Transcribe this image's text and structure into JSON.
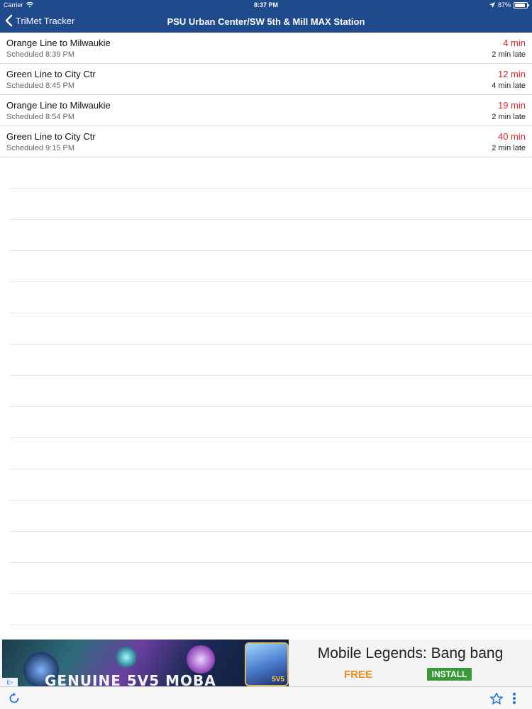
{
  "status_bar": {
    "carrier": "Carrier",
    "time": "8:37 PM",
    "battery_text": "87%",
    "battery_level": 0.87,
    "icons": [
      "wifi-icon",
      "location-arrow-icon",
      "battery-icon"
    ]
  },
  "nav": {
    "back_label": "TriMet Tracker",
    "title": "PSU Urban Center/SW 5th & Mill MAX Station"
  },
  "arrivals": [
    {
      "route": "Orange Line to Milwaukie",
      "scheduled": "Scheduled 8:39 PM",
      "eta": "4 min",
      "status": "2 min late"
    },
    {
      "route": "Green Line to City Ctr",
      "scheduled": "Scheduled 8:45 PM",
      "eta": "12 min",
      "status": "4 min late"
    },
    {
      "route": "Orange Line to Milwaukie",
      "scheduled": "Scheduled 8:54 PM",
      "eta": "19 min",
      "status": "2 min late"
    },
    {
      "route": "Green Line to City Ctr",
      "scheduled": "Scheduled 9:15 PM",
      "eta": "40 min",
      "status": "2 min late"
    }
  ],
  "ad": {
    "image_caption": "GENUINE 5V5 MOBA",
    "badge": "5V5",
    "title": "Mobile Legends: Bang bang",
    "price": "FREE",
    "cta": "INSTALL",
    "choices_icon": "adchoices-icon"
  },
  "toolbar": {
    "icons": [
      "refresh-icon",
      "star-icon",
      "more-vertical-icon"
    ]
  },
  "colors": {
    "nav_bg": "#1f4a8c",
    "eta_red": "#e0242b",
    "install_green": "#3a9a3a",
    "free_orange": "#f08a1d",
    "toolbar_icon_blue": "#1a73e8"
  }
}
